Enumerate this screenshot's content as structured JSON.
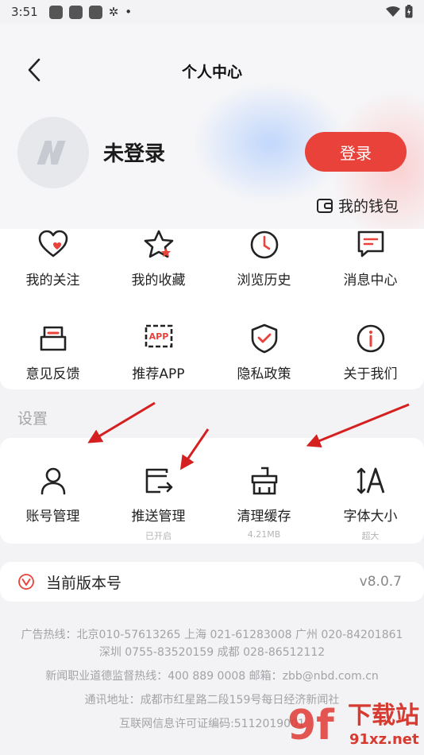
{
  "status_bar": {
    "time": "3:51",
    "dot": "•"
  },
  "header": {
    "title": "个人中心"
  },
  "profile": {
    "name": "未登录",
    "login_label": "登录",
    "wallet_label": "我的钱包"
  },
  "quick_items": [
    {
      "label": "我的关注",
      "icon": "heart-icon"
    },
    {
      "label": "我的收藏",
      "icon": "star-icon"
    },
    {
      "label": "浏览历史",
      "icon": "clock-icon"
    },
    {
      "label": "消息中心",
      "icon": "message-icon"
    },
    {
      "label": "意见反馈",
      "icon": "feedback-icon"
    },
    {
      "label": "推荐APP",
      "icon": "app-icon"
    },
    {
      "label": "隐私政策",
      "icon": "shield-icon"
    },
    {
      "label": "关于我们",
      "icon": "info-icon"
    }
  ],
  "settings": {
    "section_label": "设置",
    "items": [
      {
        "label": "账号管理",
        "sub": "",
        "icon": "user-icon"
      },
      {
        "label": "推送管理",
        "sub": "已开启",
        "icon": "push-icon"
      },
      {
        "label": "清理缓存",
        "sub": "4.21MB",
        "icon": "broom-icon"
      },
      {
        "label": "字体大小",
        "sub": "超大",
        "icon": "font-size-icon"
      }
    ]
  },
  "version": {
    "label": "当前版本号",
    "value": "v8.0.7"
  },
  "footer": {
    "hotline_1": "广告热线：北京010-57613265 上海 021-61283008 广州 020-84201861",
    "hotline_2": "深圳 0755-83520159 成都 028-86512112",
    "ethics": "新闻职业道德监督热线：400 889 0008    邮箱：zbb@nbd.com.cn",
    "address": "通讯地址：成都市红星路二段159号每日经济新闻社",
    "license": "互联网信息许可证编码:5112019001"
  },
  "watermark": {
    "text_main": "下载站",
    "text_url": "91xz.net",
    "logo": "9f"
  },
  "colors": {
    "accent": "#e8423a",
    "annotation_arrow": "#d42020"
  }
}
